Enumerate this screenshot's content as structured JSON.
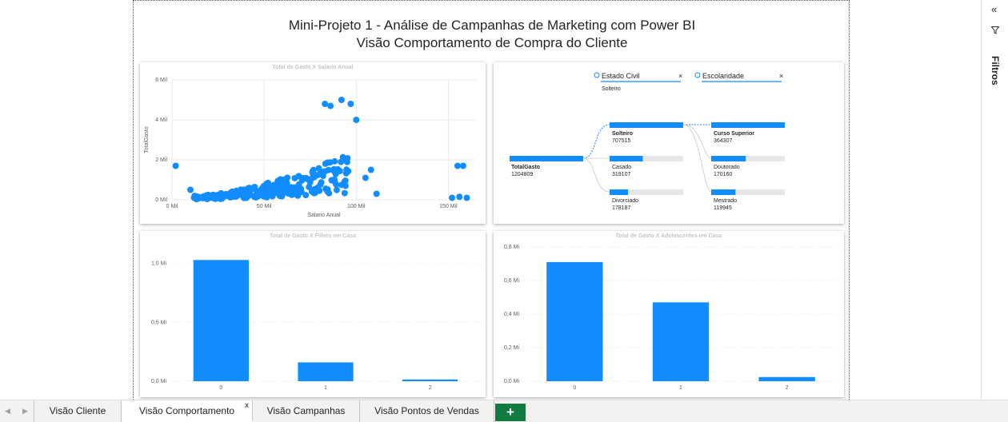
{
  "report": {
    "title_line1": "Mini-Projeto 1 - Análise de Campanhas de Marketing com Power BI",
    "title_line2": "Visão Comportamento de Compra do Cliente"
  },
  "filters_pane": {
    "label": "Filtros",
    "collapse_icon": "double-chevron-left-icon",
    "funnel_icon": "funnel-icon"
  },
  "tabs": [
    {
      "label": "Visão Cliente",
      "active": false
    },
    {
      "label": "Visão Comportamento",
      "active": true,
      "close": "x"
    },
    {
      "label": "Visão Campanhas",
      "active": false
    },
    {
      "label": "Visão Pontos de Vendas",
      "active": false
    }
  ],
  "add_tab_label": "+",
  "colors": {
    "accent": "#118dff",
    "bar_bg": "#e6e6e6",
    "add_tab": "#107c41"
  },
  "decomposition": {
    "levels": [
      {
        "title": "Estado Civil",
        "selected": "Solteiro"
      },
      {
        "title": "Escolaridade",
        "selected": ""
      }
    ],
    "root": {
      "label": "TotalGasto",
      "value": "1204809"
    },
    "level1": [
      {
        "label": "Solteiro",
        "value": "707515",
        "fraction": 1.0,
        "bold": true
      },
      {
        "label": "Casado",
        "value": "319107",
        "fraction": 0.45,
        "bold": false
      },
      {
        "label": "Divorciado",
        "value": "178187",
        "fraction": 0.25,
        "bold": false
      }
    ],
    "level2": [
      {
        "label": "Curso Superior",
        "value": "364307",
        "fraction": 1.0,
        "bold": true
      },
      {
        "label": "Doutorado",
        "value": "170160",
        "fraction": 0.47,
        "bold": false
      },
      {
        "label": "Mestrado",
        "value": "119945",
        "fraction": 0.33,
        "bold": false
      }
    ]
  },
  "chart_data": [
    {
      "type": "scatter",
      "title": "Total de Gasto X Salario Anual",
      "xlabel": "Salario Anual",
      "ylabel": "TotalGasto",
      "xlim": [
        0,
        165000
      ],
      "ylim": [
        0,
        6000000
      ],
      "xticks": [
        {
          "v": 0,
          "label": "0 Mil"
        },
        {
          "v": 50000,
          "label": "50 Mil"
        },
        {
          "v": 100000,
          "label": "100 Mil"
        },
        {
          "v": 150000,
          "label": "150 Mil"
        }
      ],
      "yticks": [
        {
          "v": 0,
          "label": "0 Mil"
        },
        {
          "v": 2000000,
          "label": "2 Mil"
        },
        {
          "v": 4000000,
          "label": "4 Mil"
        },
        {
          "v": 6000000,
          "label": "6 Mil"
        }
      ],
      "outliers": [
        {
          "x": 2000,
          "y": 1700000
        },
        {
          "x": 10000,
          "y": 500000
        },
        {
          "x": 83000,
          "y": 4800000
        },
        {
          "x": 86000,
          "y": 4700000
        },
        {
          "x": 92000,
          "y": 5000000
        },
        {
          "x": 97000,
          "y": 4800000
        },
        {
          "x": 100000,
          "y": 4000000
        },
        {
          "x": 111000,
          "y": 300000
        },
        {
          "x": 155000,
          "y": 1700000
        },
        {
          "x": 158000,
          "y": 1700000
        },
        {
          "x": 152000,
          "y": 100000
        },
        {
          "x": 156000,
          "y": 150000
        },
        {
          "x": 160000,
          "y": 100000
        },
        {
          "x": 108000,
          "y": 1500000
        },
        {
          "x": 105000,
          "y": 1100000
        }
      ],
      "cloud": {
        "x_from": 12000,
        "x_to": 98000,
        "y_base": 200000,
        "y_peak": 2400000,
        "points": 260
      }
    },
    {
      "type": "bar",
      "title": "Total de Gasto X Filhos em Casa",
      "categories": [
        "0",
        "1",
        "2"
      ],
      "values": [
        1030000,
        160000,
        15000
      ],
      "ylim": [
        0,
        1100000
      ],
      "yticks": [
        {
          "v": 0,
          "label": "0,0 Mi"
        },
        {
          "v": 500000,
          "label": "0,5 Mi"
        },
        {
          "v": 1000000,
          "label": "1,0 Mi"
        }
      ]
    },
    {
      "type": "bar",
      "title": "Total de Gasto X Adolescentes em Casa",
      "categories": [
        "0",
        "1",
        "2"
      ],
      "values": [
        710000,
        470000,
        25000
      ],
      "ylim": [
        0,
        800000
      ],
      "yticks": [
        {
          "v": 0,
          "label": "0,0 Mi"
        },
        {
          "v": 200000,
          "label": "0,2 Mi"
        },
        {
          "v": 400000,
          "label": "0,4 Mi"
        },
        {
          "v": 600000,
          "label": "0,6 Mi"
        },
        {
          "v": 800000,
          "label": "0,8 Mi"
        }
      ]
    }
  ]
}
